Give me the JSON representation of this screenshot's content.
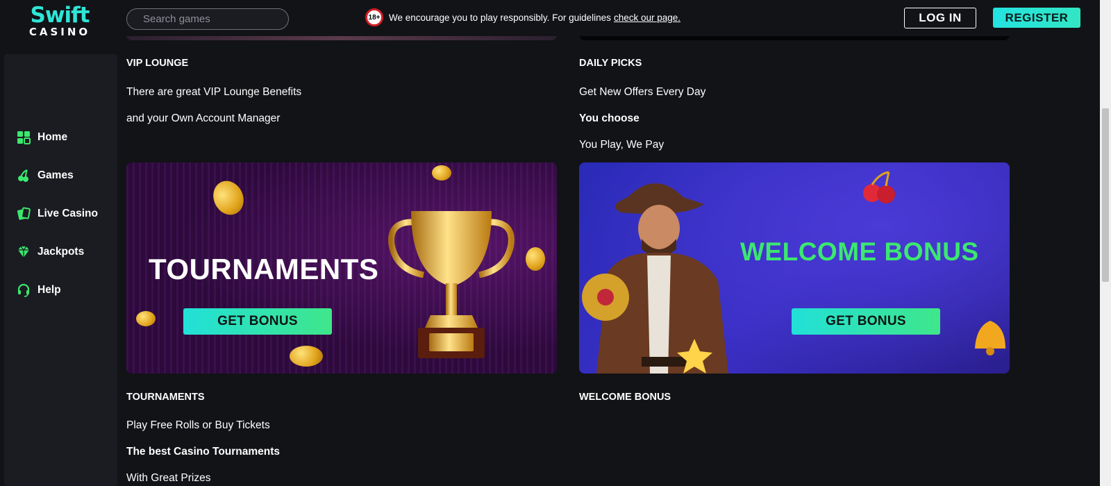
{
  "brand": {
    "name_top": "Swift",
    "name_bottom": "CASINO",
    "accent": "#2ee6d6"
  },
  "header": {
    "search_placeholder": "Search games",
    "age_badge": "18+",
    "notice_text": "We encourage you to play responsibly. For guidelines",
    "notice_link": "check our page.",
    "login_label": "LOG IN",
    "register_label": "REGISTER"
  },
  "sidebar": {
    "items": [
      {
        "label": "Home",
        "icon": "grid-icon"
      },
      {
        "label": "Games",
        "icon": "cherries-icon"
      },
      {
        "label": "Live Casino",
        "icon": "cards-icon"
      },
      {
        "label": "Jackpots",
        "icon": "diamond-icon"
      },
      {
        "label": "Help",
        "icon": "headset-icon"
      }
    ]
  },
  "sections": {
    "vip": {
      "title": "VIP LOUNGE",
      "lines": [
        "There are great VIP Lounge Benefits",
        "and your Own Account Manager"
      ]
    },
    "daily": {
      "title": "DAILY PICKS",
      "lines": [
        "Get New Offers Every Day",
        "You choose",
        "You Play, We Pay"
      ]
    },
    "tournaments": {
      "banner_title": "TOURNAMENTS",
      "banner_button": "GET BONUS",
      "title": "TOURNAMENTS",
      "lines": [
        "Play Free Rolls or Buy Tickets",
        "The best Casino Tournaments",
        "With Great Prizes"
      ]
    },
    "welcome": {
      "banner_title": "WELCOME BONUS",
      "banner_button": "GET BONUS",
      "title": "WELCOME BONUS"
    }
  },
  "colors": {
    "background": "#121317",
    "sidebar": "#1b1c21",
    "button_gradient_start": "#21e0d8",
    "button_gradient_end": "#3fe68a",
    "welcome_title": "#3be86f"
  }
}
